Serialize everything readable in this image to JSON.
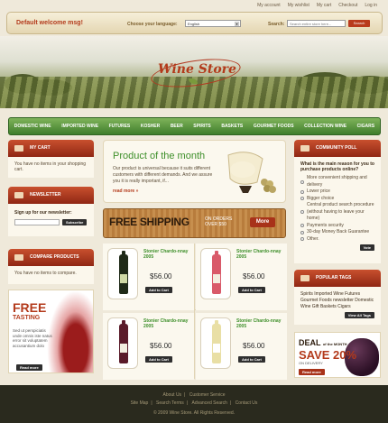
{
  "toplinks": [
    "My account",
    "My wishlist",
    "My cart",
    "Checkout",
    "Log in"
  ],
  "header": {
    "welcome": "Default welcome msg!",
    "language_label": "Choose your language:",
    "language_value": "English",
    "search_label": "Search:",
    "search_placeholder": "Search entire store here...",
    "search_button": "Search"
  },
  "logo": "Wine Store",
  "nav": [
    "DOMESTIC WINE",
    "IMPORTED WINE",
    "FUTURES",
    "KOSHER",
    "BEER",
    "SPIRITS",
    "BASKETS",
    "GOURMET FOODS",
    "COLLECTION WINE",
    "CIGARS"
  ],
  "cart": {
    "title": "MY CART",
    "text": "You have no items in your shopping cart."
  },
  "newsletter": {
    "title": "NEWSLETTER",
    "label": "Sign up for our newsletter:",
    "button": "Subscribe"
  },
  "compare": {
    "title": "COMPARE PRODUCTS",
    "text": "You have no items to compare."
  },
  "tasting": {
    "title": "FREE",
    "subtitle": "TASTING",
    "text": "Sed ut perspiciatis unde omnis iste natus error sit voluptatem accusantium dolo",
    "button": "Read more"
  },
  "potm": {
    "title": "Product of the month",
    "text": "Our product is universal because it suits different customers with different demands. And we assure you it is really important, if...",
    "more": "read more »"
  },
  "shipping": {
    "title": "FREE SHIPPING",
    "sub1": "ON ORDERS",
    "sub2": "OVER $50",
    "button": "More"
  },
  "products": [
    {
      "name": "Stonier Chardo-nnay 2005",
      "price": "$56.00",
      "button": "Add to Cart",
      "color": "#cfd9a6"
    },
    {
      "name": "Stonier Chardo-nnay 2005",
      "price": "$56.00",
      "button": "Add to Cart",
      "color": "#d95a6a"
    },
    {
      "name": "Stonier Chardo-nnay 2005",
      "price": "$56.00",
      "button": "Add to Cart",
      "color": "#5a1b2a"
    },
    {
      "name": "Stonier Chardo-nnay 2005",
      "price": "$56.00",
      "button": "Add to Cart",
      "color": "#e9dfa5"
    }
  ],
  "poll": {
    "title": "COMMUNITY POLL",
    "question": "What is the main reason for you to purchase products online?",
    "options": [
      "More convenient shipping and delivery",
      "Lower price",
      "Bigger choice",
      "Central product search procedure (without having to leave your home)",
      "Payments security",
      "30-day Money Back Guarantee",
      "Other."
    ],
    "button": "Vote"
  },
  "tags": {
    "title": "POPULAR TAGS",
    "cloud": "Spirits Imported Wine Futures Gourmet Foods newsletter Domestic Wine Gift Baskets Cigars",
    "button": "View All Tags"
  },
  "deal": {
    "t1": "DEAL",
    "t1b": "of the MONTH",
    "t2": "SAVE 20%",
    "t3": "ON DELIVERY",
    "button": "Read more"
  },
  "footer": {
    "row1": [
      "About Us",
      "Customer Service"
    ],
    "row2": [
      "Site Map",
      "Search Terms",
      "Advanced Search",
      "Contact Us"
    ],
    "copyright": "© 2009 Wine Store. All Rights Reserved."
  }
}
